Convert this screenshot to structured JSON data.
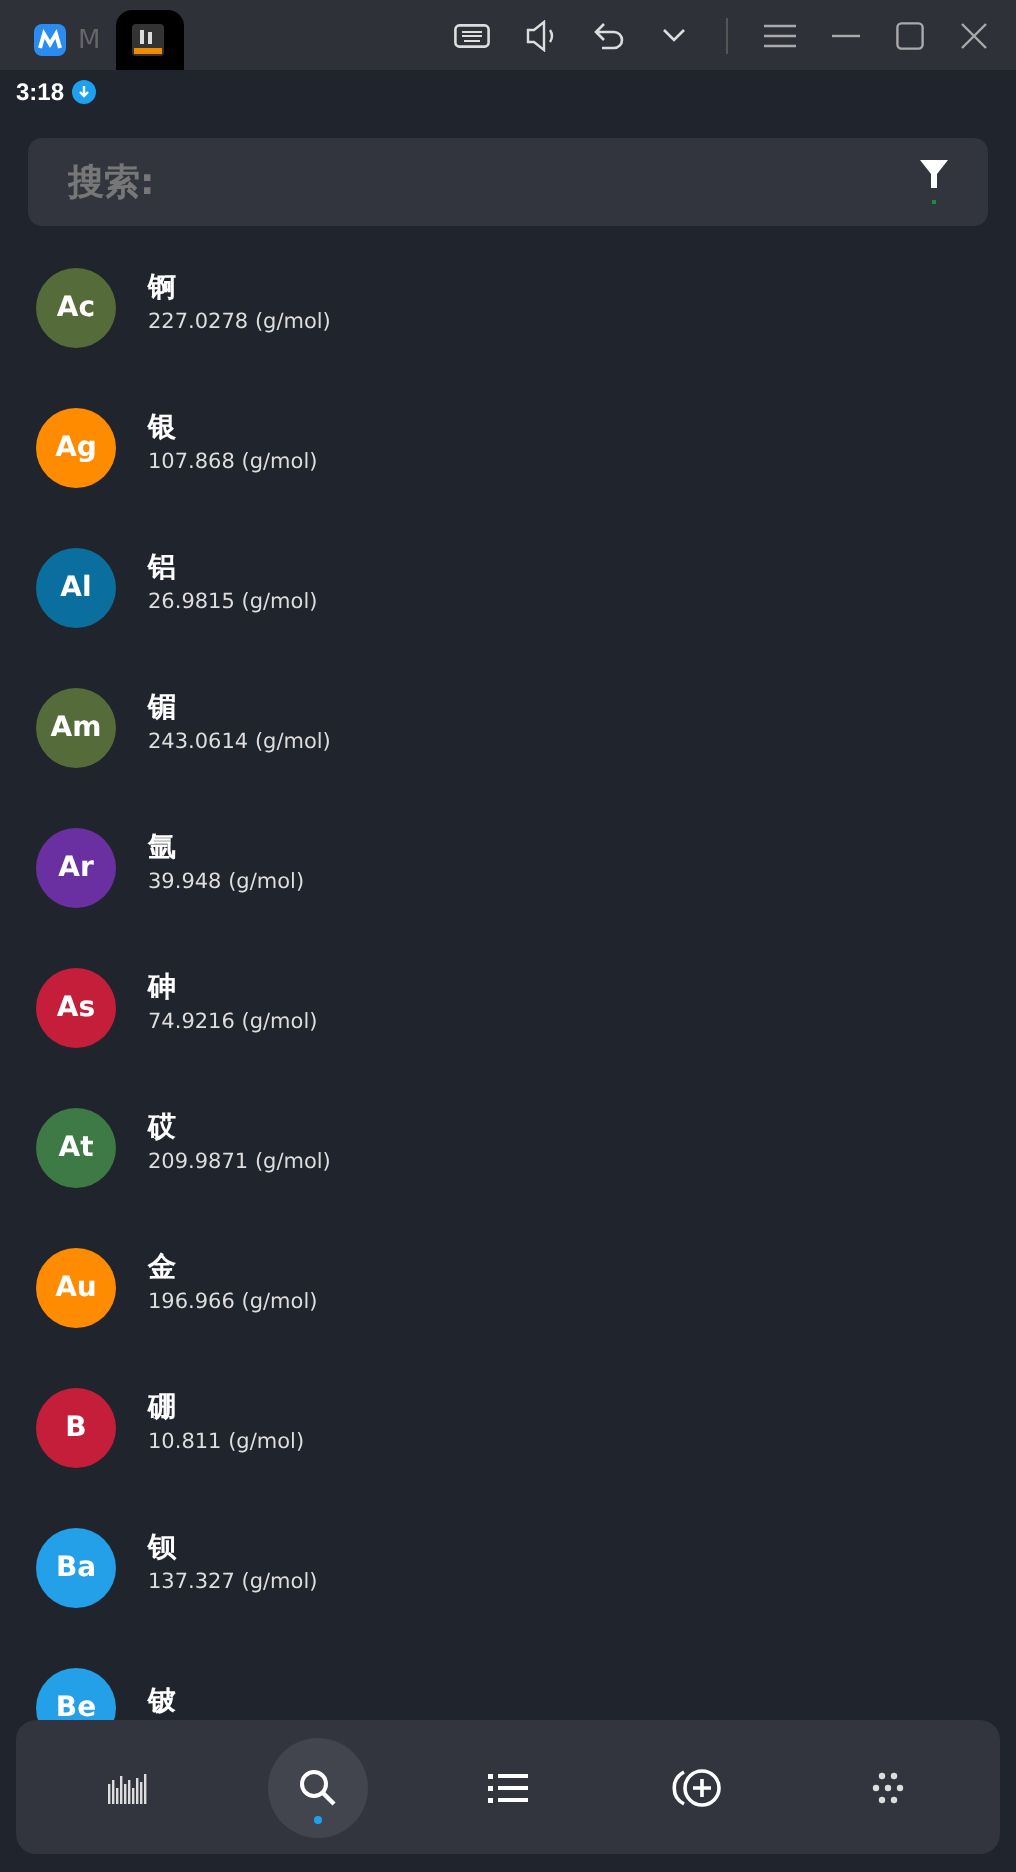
{
  "window": {
    "tabs": [
      {
        "label": "M",
        "selected": false,
        "kind": "m"
      },
      {
        "selected": true,
        "kind": "pt"
      }
    ]
  },
  "status_bar": {
    "time": "3:18"
  },
  "search": {
    "placeholder": "搜索:"
  },
  "elements": [
    {
      "symbol": "Ac",
      "name": "锕",
      "mass": "227.0278 (g/mol)",
      "color": "#556b3a"
    },
    {
      "symbol": "Ag",
      "name": "银",
      "mass": "107.868 (g/mol)",
      "color": "#ff8c00"
    },
    {
      "symbol": "Al",
      "name": "铝",
      "mass": "26.9815 (g/mol)",
      "color": "#0a6e9e"
    },
    {
      "symbol": "Am",
      "name": "镅",
      "mass": "243.0614 (g/mol)",
      "color": "#556b3a"
    },
    {
      "symbol": "Ar",
      "name": "氩",
      "mass": "39.948 (g/mol)",
      "color": "#6a2fa0"
    },
    {
      "symbol": "As",
      "name": "砷",
      "mass": "74.9216 (g/mol)",
      "color": "#c41e3a"
    },
    {
      "symbol": "At",
      "name": "砹",
      "mass": "209.9871 (g/mol)",
      "color": "#3d7a45"
    },
    {
      "symbol": "Au",
      "name": "金",
      "mass": "196.966 (g/mol)",
      "color": "#ff8c00"
    },
    {
      "symbol": "B",
      "name": "硼",
      "mass": "10.811 (g/mol)",
      "color": "#c41e3a"
    },
    {
      "symbol": "Ba",
      "name": "钡",
      "mass": "137.327 (g/mol)",
      "color": "#23a0e8"
    },
    {
      "symbol": "Be",
      "name": "铍",
      "color": "#23a0e8"
    }
  ],
  "nav": [
    {
      "kind": "bars",
      "selected": false
    },
    {
      "kind": "search",
      "selected": true
    },
    {
      "kind": "list",
      "selected": false
    },
    {
      "kind": "add",
      "selected": false
    },
    {
      "kind": "dots",
      "selected": false
    }
  ]
}
